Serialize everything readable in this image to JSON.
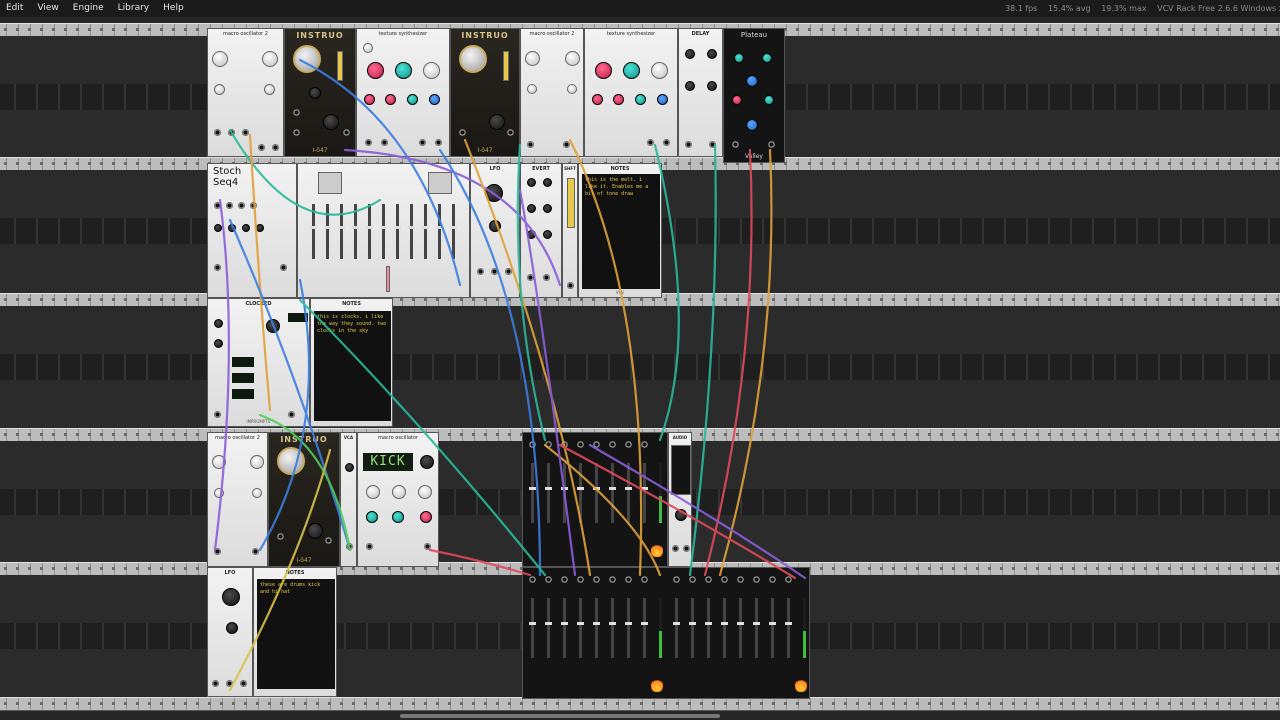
{
  "menu": [
    "Edit",
    "View",
    "Engine",
    "Library",
    "Help"
  ],
  "status": {
    "fps": "38.1 fps",
    "cpu": "15.4% avg",
    "max": "19.3% max",
    "version": "VCV Rack Free 2.6.6 Windows x"
  },
  "modules": {
    "macro1": "macro oscillator 2",
    "instruo1": "INSTRUO",
    "instruo1_sub": "I-ō47",
    "texture1": "texture synthesizer",
    "instruo2": "INSTRUO",
    "instruo2_sub": "I-ō47",
    "macro2": "macro oscillator 2",
    "texture2": "texture synthesizer",
    "delay": "DELAY",
    "plateau": "Plateau",
    "plateau_sub": "Valley",
    "stoch": "Stoch\nSeq4",
    "lfo1": "LFO",
    "evert": "EVERT",
    "shift": "SHFT",
    "notes1_title": "NOTES",
    "notes1_text": "this is the melt. i like it. Enables me a bit of tone draw",
    "clocked": "CLOCKED",
    "impromptu": "IMPROMPTU",
    "notes2_title": "NOTES",
    "notes2_text": "this is clocks. i like the way they sound. two clocks in the sky",
    "macro3": "macro oscillator 2",
    "instruo3": "INSTRUO",
    "instruo3_sub": "I-ō47",
    "vca": "VCA",
    "macro4": "macro oscillator",
    "kick": "KICK",
    "lfo2": "LFO",
    "notes3_title": "NOTES",
    "notes3_text": "these are drums kick and hi hat",
    "audio": "AUDIO",
    "vcv": "VCV"
  },
  "colors": {
    "wire_teal": "#2ab89a",
    "wire_blue": "#3b7ee0",
    "wire_purple": "#8a5ed8",
    "wire_orange": "#e0a03a",
    "wire_red": "#e04a5a",
    "wire_green": "#4ccf5a",
    "wire_yellow": "#d8c24a"
  }
}
